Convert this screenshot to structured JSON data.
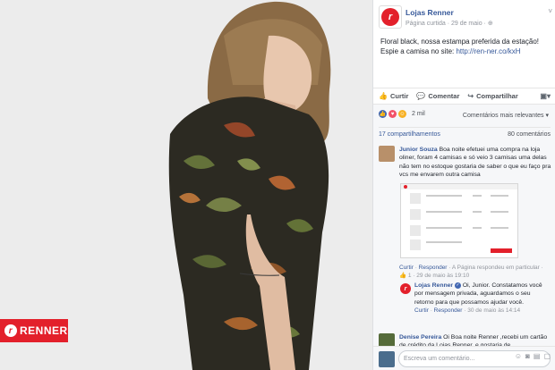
{
  "photo": {
    "brand_label": "RENNER",
    "brand_mark": "r"
  },
  "post": {
    "page_name": "Lojas Renner",
    "avatar_letter": "r",
    "meta": "Página curtida · 29 de maio ·",
    "text_line1": "Floral black, nossa estampa preferida da estação!",
    "text_line2_prefix": "Espie a camisa no site: ",
    "link": "http://ren-ner.co/kxH"
  },
  "actions": {
    "like": "Curtir",
    "comment": "Comentar",
    "share": "Compartilhar"
  },
  "summary": {
    "reaction_count": "2 mil",
    "relevance": "Comentários mais relevantes ▾",
    "shares": "17 compartilhamentos",
    "comments": "80 comentários"
  },
  "comments": [
    {
      "author": "Junior Souza",
      "text": "Boa noite efetuei uma compra na loja oliner, foram 4 camisas e só veio 3 camisas uma delas não tem no estoque gostaria de saber o que eu faço pra vcs me envarem outra camisa",
      "meta_like": "Curtir",
      "meta_reply": "Responder",
      "meta_rest": " · A Página respondeu em particular · 👍 1 · 29 de maio às 19:10"
    },
    {
      "author": "Denise Pereira",
      "text": "Oi Boa noite Renner ,recebi um cartão de crédito da Lojas Renner, e gostaria de"
    }
  ],
  "reply": {
    "author": "Lojas Renner",
    "avatar_letter": "r",
    "text": "Oi, Junior. Constatamos você por mensagem privada, aguardamos o seu retorno para que possamos ajudar você.",
    "meta_like": "Curtir",
    "meta_reply": "Responder",
    "meta_rest": " · 30 de maio às 14:14"
  },
  "comment_input": {
    "placeholder": "Escreva um comentário..."
  },
  "colors": {
    "brand_red": "#e3202b",
    "link_blue": "#365899"
  }
}
